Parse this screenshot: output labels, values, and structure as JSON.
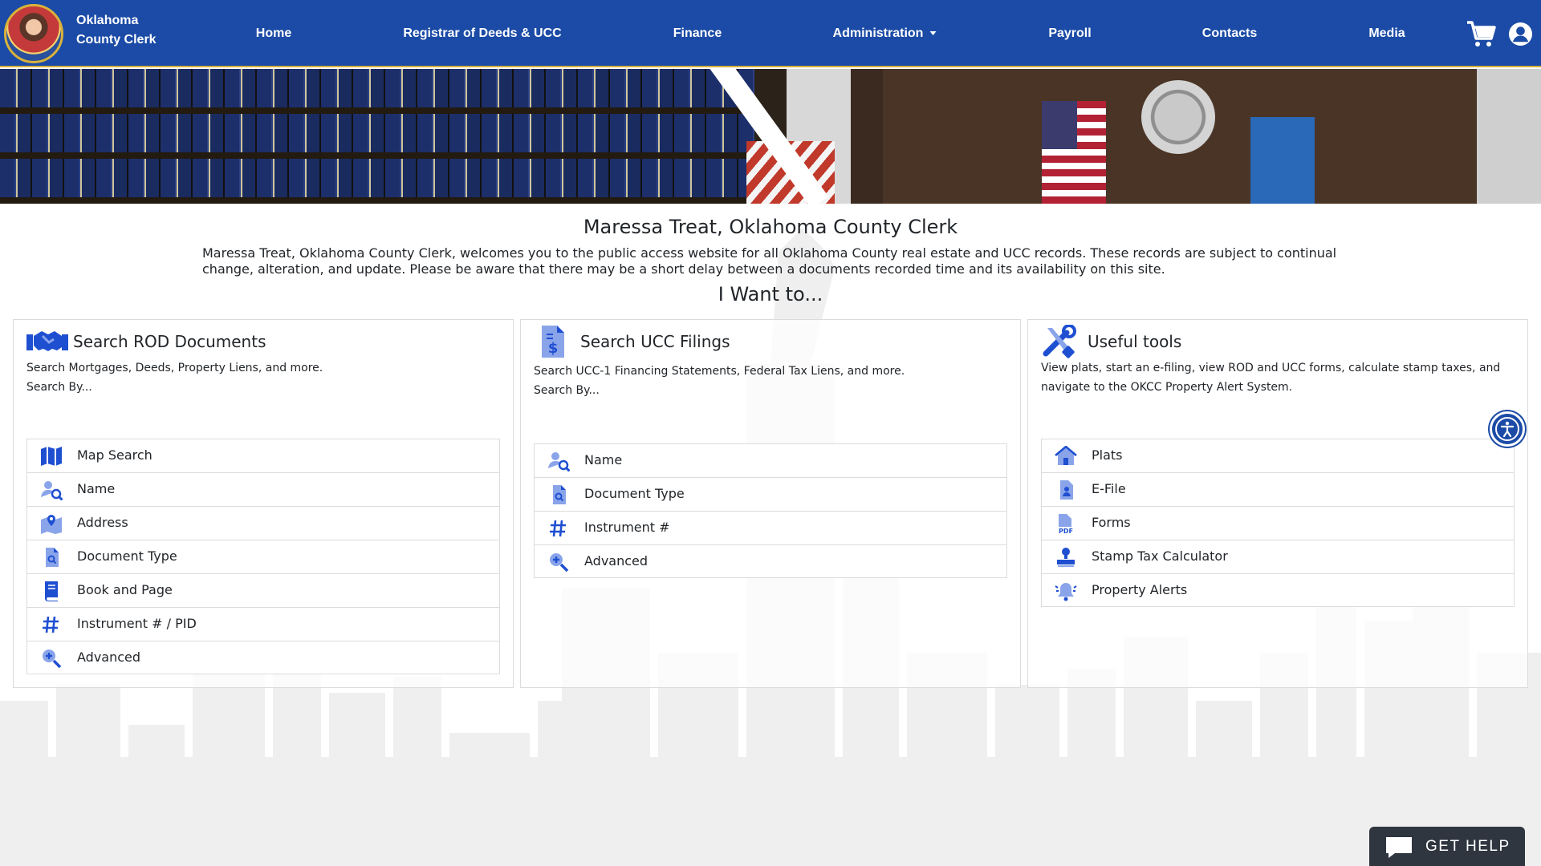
{
  "header": {
    "brand_line1": "Oklahoma",
    "brand_line2": "County Clerk",
    "nav": [
      {
        "label": "Home"
      },
      {
        "label": "Registrar of Deeds & UCC"
      },
      {
        "label": "Finance"
      },
      {
        "label": "Administration"
      },
      {
        "label": "Payroll"
      },
      {
        "label": "Contacts"
      },
      {
        "label": "Media"
      }
    ],
    "cart_icon": "cart-icon",
    "user_icon": "user-circle-icon"
  },
  "intro": {
    "title": "Maressa Treat, Oklahoma County Clerk",
    "text": "Maressa Treat, Oklahoma County Clerk, welcomes you to the public access website for all Oklahoma County real estate and UCC records. These records are subject to continual change, alteration, and update. Please be aware that there may be a short delay between a documents recorded time and its availability on this site.",
    "want": "I Want to..."
  },
  "cards": [
    {
      "title": "Search ROD Documents",
      "desc": "Search Mortgages, Deeds, Property Liens, and more.",
      "search_by": "Search By...",
      "items": [
        {
          "label": "Map Search",
          "icon": "map-icon"
        },
        {
          "label": "Name",
          "icon": "user-search-icon"
        },
        {
          "label": "Address",
          "icon": "map-pin-icon"
        },
        {
          "label": "Document Type",
          "icon": "file-search-icon"
        },
        {
          "label": "Book and Page",
          "icon": "book-icon"
        },
        {
          "label": "Instrument # / PID",
          "icon": "hashtag-icon"
        },
        {
          "label": "Advanced",
          "icon": "zoom-in-icon"
        }
      ]
    },
    {
      "title": "Search UCC Filings",
      "desc": "Search UCC-1 Financing Statements, Federal Tax Liens, and more.",
      "search_by": "Search By...",
      "items": [
        {
          "label": "Name",
          "icon": "user-search-icon"
        },
        {
          "label": "Document Type",
          "icon": "file-search-icon"
        },
        {
          "label": "Instrument #",
          "icon": "hashtag-icon"
        },
        {
          "label": "Advanced",
          "icon": "zoom-in-icon"
        }
      ]
    },
    {
      "title": "Useful tools",
      "desc": "View plats, start an e-filing, view ROD and UCC forms, calculate stamp taxes, and navigate to the OKCC Property Alert System.",
      "items": [
        {
          "label": "Plats",
          "icon": "home-icon"
        },
        {
          "label": "E-File",
          "icon": "file-user-icon"
        },
        {
          "label": "Forms",
          "icon": "pdf-icon"
        },
        {
          "label": "Stamp Tax Calculator",
          "icon": "stamp-icon"
        },
        {
          "label": "Property Alerts",
          "icon": "bell-icon"
        }
      ]
    }
  ],
  "help": {
    "label": "GET HELP"
  },
  "colors": {
    "nav_bg": "#1b4ba6",
    "accent": "#1f4fd1",
    "icon_light": "#8aa4ea",
    "gold": "#d4b13a"
  }
}
